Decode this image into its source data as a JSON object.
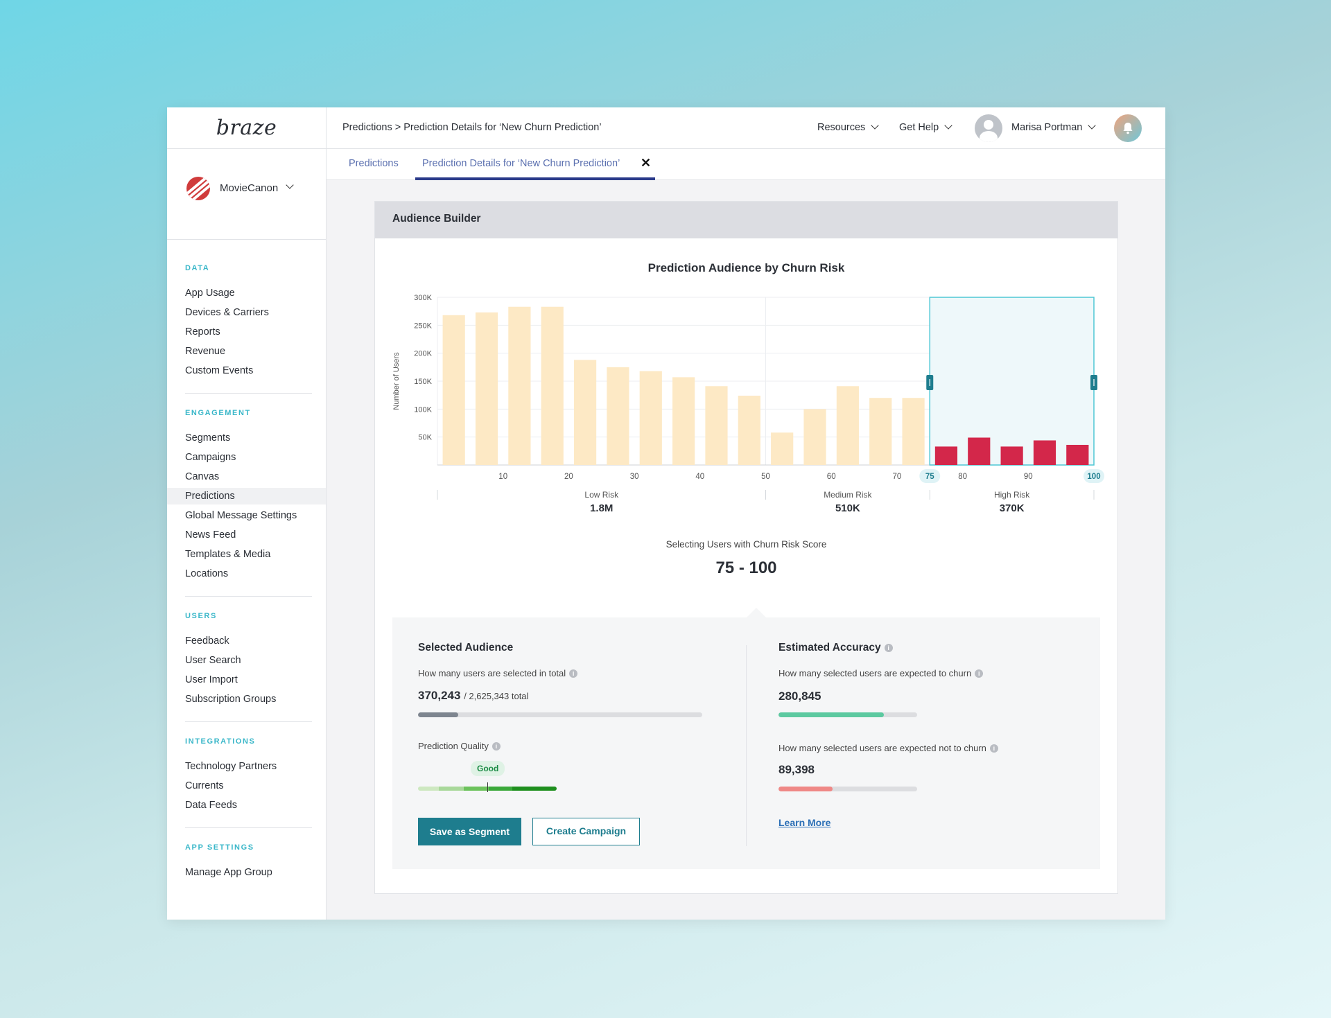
{
  "logo": "braze",
  "app_switcher": {
    "name": "MovieCanon"
  },
  "sidebar": {
    "sections": [
      {
        "heading": "DATA",
        "items": [
          "App Usage",
          "Devices & Carriers",
          "Reports",
          "Revenue",
          "Custom Events"
        ]
      },
      {
        "heading": "ENGAGEMENT",
        "items": [
          "Segments",
          "Campaigns",
          "Canvas",
          "Predictions",
          "Global Message Settings",
          "News Feed",
          "Templates & Media",
          "Locations"
        ]
      },
      {
        "heading": "USERS",
        "items": [
          "Feedback",
          "User Search",
          "User Import",
          "Subscription Groups"
        ]
      },
      {
        "heading": "INTEGRATIONS",
        "items": [
          "Technology Partners",
          "Currents",
          "Data Feeds"
        ]
      },
      {
        "heading": "APP SETTINGS",
        "items": [
          "Manage App Group"
        ]
      }
    ],
    "active_item": "Predictions"
  },
  "topbar": {
    "breadcrumb": "Predictions > Prediction Details for ‘New Churn Prediction’",
    "resources": "Resources",
    "help": "Get Help",
    "user": "Marisa Portman"
  },
  "tabs": {
    "first": "Predictions",
    "second": "Prediction Details for ‘New Churn Prediction’"
  },
  "card": {
    "header": "Audience Builder",
    "chart_title": "Prediction Audience by Churn Risk",
    "selecting_label": "Selecting Users with Churn Risk Score",
    "selected_range": "75 - 100"
  },
  "chart_data": {
    "type": "bar",
    "title": "Prediction Audience by Churn Risk",
    "ylabel": "Number of Users",
    "ylim": [
      0,
      300000
    ],
    "yticks": [
      {
        "value": 300000,
        "label": "300K"
      },
      {
        "value": 250000,
        "label": "250K"
      },
      {
        "value": 200000,
        "label": "200K"
      },
      {
        "value": 150000,
        "label": "150K"
      },
      {
        "value": 100000,
        "label": "100K"
      },
      {
        "value": 50000,
        "label": "50K"
      }
    ],
    "xlim": [
      0,
      100
    ],
    "xticks": [
      10,
      20,
      30,
      40,
      50,
      60,
      70,
      80,
      90
    ],
    "selection": [
      75,
      100
    ],
    "bin_width": 5,
    "bins": [
      {
        "start": 0,
        "value": 268000
      },
      {
        "start": 5,
        "value": 273000
      },
      {
        "start": 10,
        "value": 283000
      },
      {
        "start": 15,
        "value": 283000
      },
      {
        "start": 20,
        "value": 188000
      },
      {
        "start": 25,
        "value": 175000
      },
      {
        "start": 30,
        "value": 168000
      },
      {
        "start": 35,
        "value": 157000
      },
      {
        "start": 40,
        "value": 141000
      },
      {
        "start": 45,
        "value": 124000
      },
      {
        "start": 50,
        "value": 58000
      },
      {
        "start": 55,
        "value": 100000
      },
      {
        "start": 60,
        "value": 141000
      },
      {
        "start": 65,
        "value": 120000
      },
      {
        "start": 70,
        "value": 120000
      },
      {
        "start": 75,
        "value": 33000
      },
      {
        "start": 80,
        "value": 49000
      },
      {
        "start": 85,
        "value": 33000
      },
      {
        "start": 90,
        "value": 44000
      },
      {
        "start": 95,
        "value": 36000
      }
    ],
    "groups": [
      {
        "name": "Low Risk",
        "value": "1.8M",
        "range": [
          0,
          50
        ]
      },
      {
        "name": "Medium Risk",
        "value": "510K",
        "range": [
          50,
          75
        ]
      },
      {
        "name": "High Risk",
        "value": "370K",
        "range": [
          75,
          100
        ]
      }
    ],
    "colors": {
      "unselected": "#fde9c5",
      "selected": "#d3274a",
      "selection_border": "#4ec7d4"
    }
  },
  "selected_audience": {
    "title": "Selected Audience",
    "question": "How many users are selected in total",
    "value": "370,243",
    "total": "/ 2,625,343 total",
    "fraction": 0.141,
    "quality_label": "Prediction Quality",
    "quality_badge": "Good",
    "save_button": "Save as Segment",
    "campaign_button": "Create Campaign"
  },
  "estimated_accuracy": {
    "title": "Estimated Accuracy",
    "churn_question": "How many selected users are expected to churn",
    "churn_value": "280,845",
    "churn_fraction": 0.76,
    "not_churn_question": "How many selected users are expected not to churn",
    "not_churn_value": "89,398",
    "not_churn_fraction": 0.39,
    "learn_more": "Learn More"
  }
}
